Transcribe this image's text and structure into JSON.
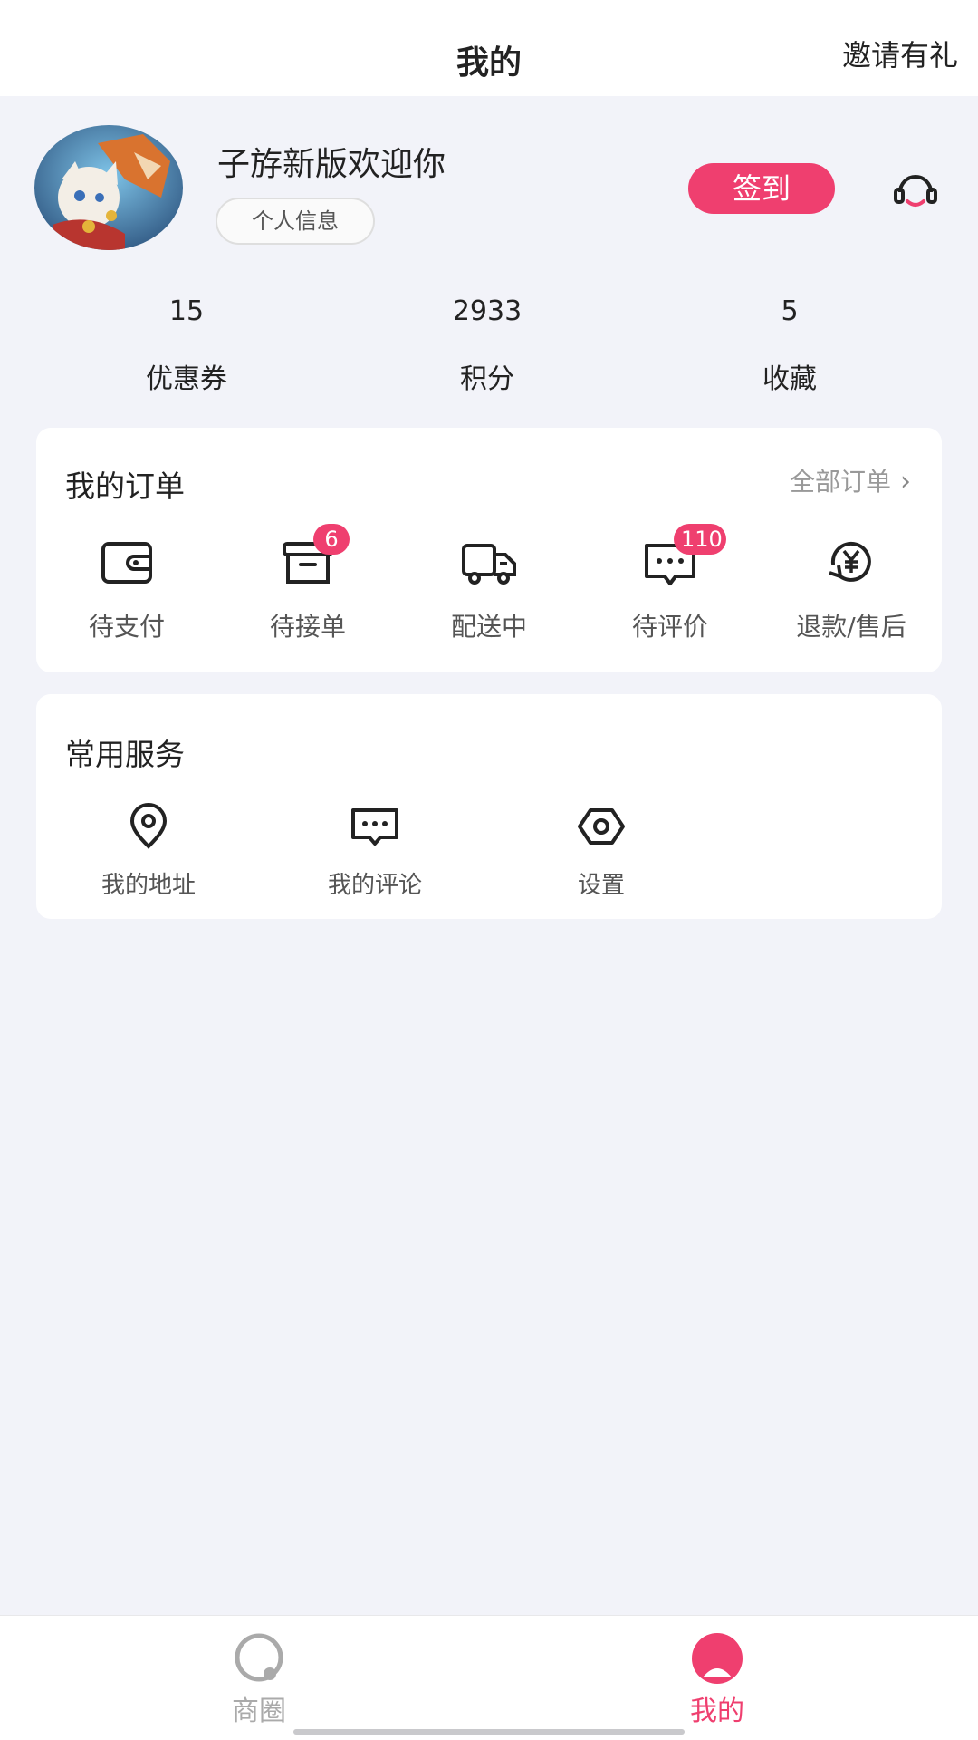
{
  "header": {
    "title": "我的",
    "invite": "邀请有礼"
  },
  "profile": {
    "username": "子斿新版欢迎你",
    "info_button": "个人信息",
    "checkin_button": "签到"
  },
  "stats": [
    {
      "value": "15",
      "label": "优惠券"
    },
    {
      "value": "2933",
      "label": "积分"
    },
    {
      "value": "5",
      "label": "收藏"
    }
  ],
  "orders": {
    "title": "我的订单",
    "all_link": "全部订单",
    "items": [
      {
        "label": "待支付",
        "icon": "wallet-icon",
        "badge": null
      },
      {
        "label": "待接单",
        "icon": "box-icon",
        "badge": "6"
      },
      {
        "label": "配送中",
        "icon": "truck-icon",
        "badge": null
      },
      {
        "label": "待评价",
        "icon": "comment-icon",
        "badge": "110"
      },
      {
        "label": "退款/售后",
        "icon": "refund-icon",
        "badge": null
      }
    ]
  },
  "services": {
    "title": "常用服务",
    "items": [
      {
        "label": "我的地址",
        "icon": "location-pin-icon"
      },
      {
        "label": "我的评论",
        "icon": "comment-icon"
      },
      {
        "label": "设置",
        "icon": "gear-icon"
      }
    ]
  },
  "tabbar": {
    "items": [
      {
        "label": "商圈",
        "icon": "shop-circle-icon",
        "active": false
      },
      {
        "label": "我的",
        "icon": "user-icon",
        "active": true
      }
    ]
  },
  "colors": {
    "accent": "#ef3f6f",
    "background": "#f2f3f9",
    "muted_text": "#999999"
  }
}
